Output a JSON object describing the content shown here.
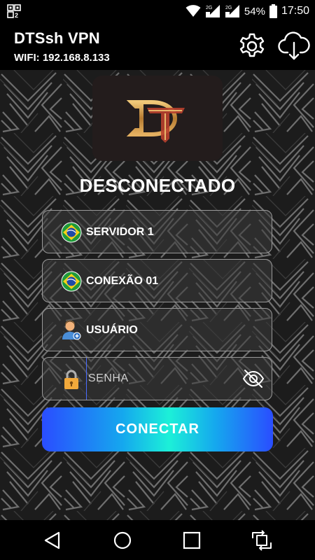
{
  "status_bar": {
    "battery": "54%",
    "time": "17:50",
    "icons": [
      "notification-icon",
      "wifi-icon",
      "signal-sim1-icon",
      "signal-sim2-icon",
      "battery-icon"
    ],
    "sim1_label": "2G",
    "sim2_label": "2G"
  },
  "app": {
    "title": "DTSsh VPN",
    "wifi": "WIFI: 192.168.8.133"
  },
  "main": {
    "logo_letters": "DT",
    "status": "DESCONECTADO",
    "server": {
      "label": "SERVIDOR 1",
      "icon": "brazil-flag-icon"
    },
    "connection": {
      "label": "CONEXÃO 01",
      "icon": "brazil-flag-icon"
    },
    "user": {
      "label": "USUÁRIO",
      "icon": "user-add-icon"
    },
    "password": {
      "placeholder": "SENHA",
      "icon": "padlock-icon"
    },
    "connect_label": "CONECTAR"
  },
  "colors": {
    "connect_gradient": [
      "#2a4dff",
      "#1cf0d8"
    ],
    "logo_gold": "#d2a450",
    "logo_red": "#b8402e"
  },
  "nav": {
    "icons": [
      "back-icon",
      "home-icon",
      "recents-icon",
      "rotate-icon"
    ]
  }
}
